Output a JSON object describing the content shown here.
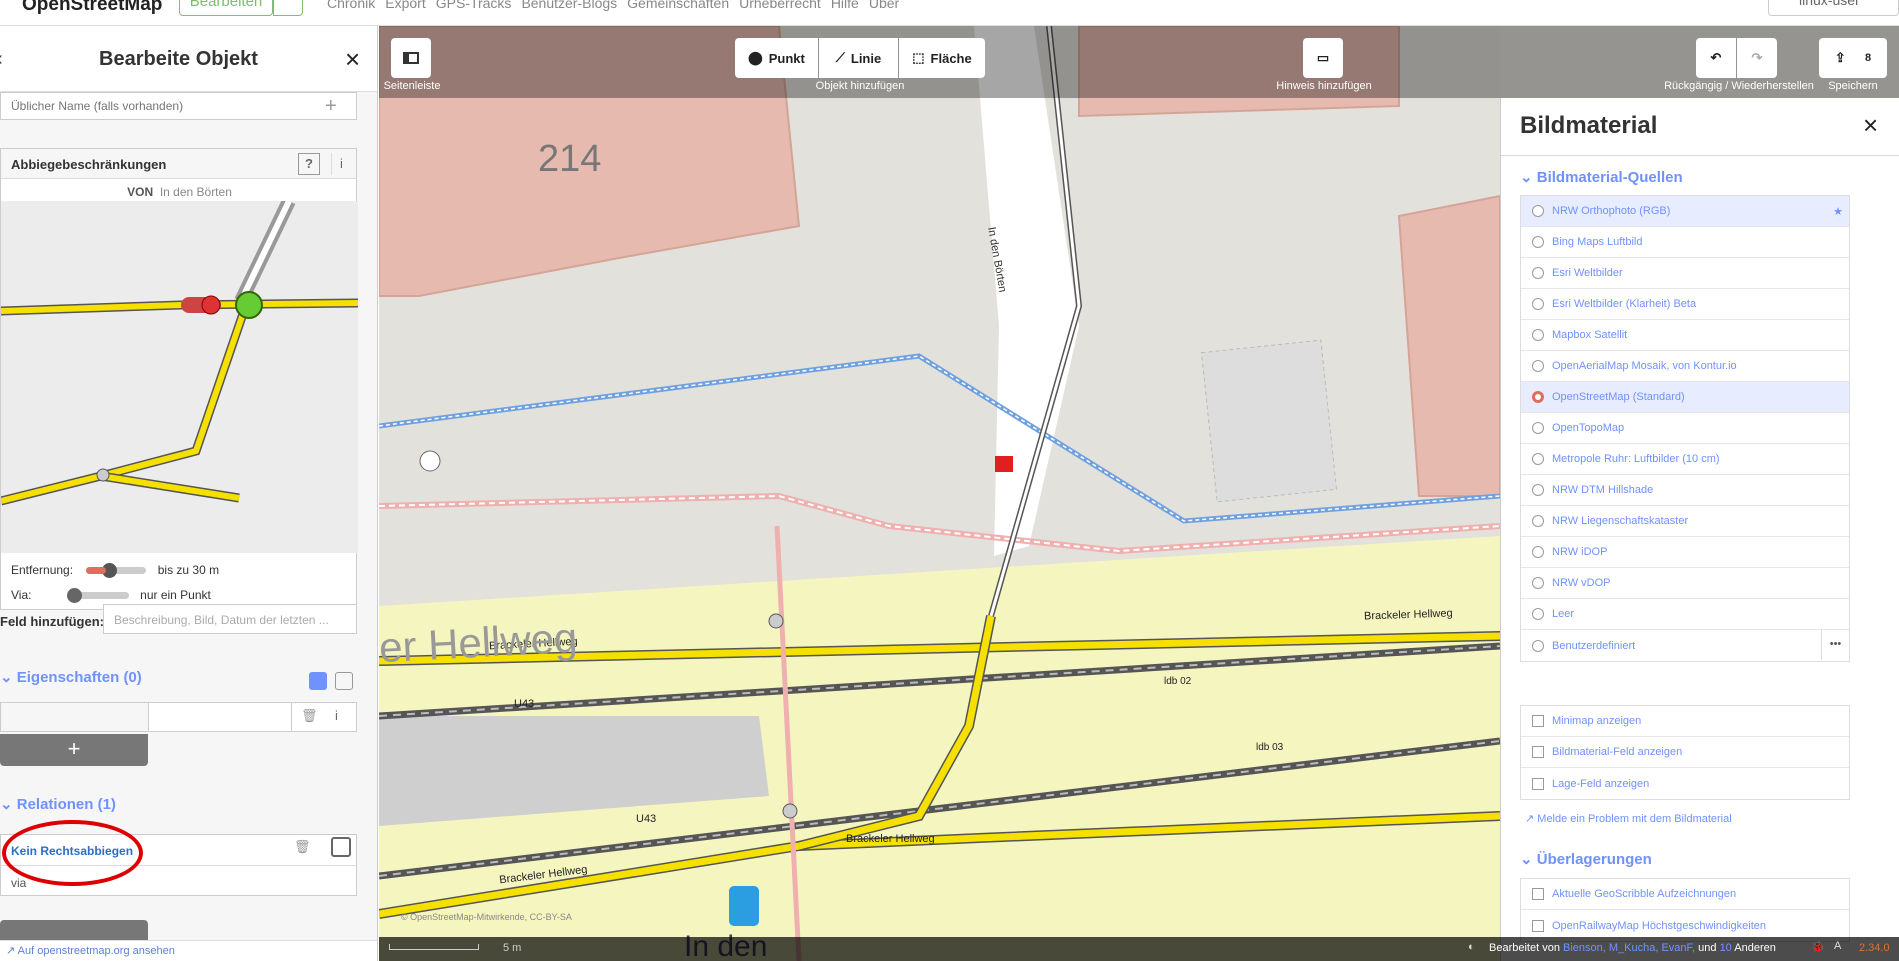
{
  "header": {
    "logo": "OpenStreetMap",
    "edit_button": "Bearbeiten",
    "nav": [
      "Chronik",
      "Export",
      "GPS-Tracks",
      "Benutzer-Blogs",
      "Gemeinschaften",
      "Urheberrecht",
      "Hilfe",
      "Über"
    ],
    "user": "linux-user"
  },
  "sidebar": {
    "title": "Bearbeite Objekt",
    "name_placeholder": "Üblicher Name (falls vorhanden)",
    "turn": {
      "label": "Abbiegebeschränkungen",
      "von_label": "VON",
      "von_value": "In den Börten",
      "distance_label": "Entfernung:",
      "distance_value": "bis zu 30 m",
      "via_label": "Via:",
      "via_value": "nur ein Punkt"
    },
    "field_add_label": "Feld hinzufügen:",
    "field_add_placeholder": "Beschreibung, Bild, Datum der letzten ...",
    "tags_title": "Eigenschaften (0)",
    "add_tag": "+",
    "relations_title": "Relationen (1)",
    "relation_name": "Kein Rechtsabbiegen",
    "relation_role": "via",
    "footer_link": "Auf openstreetmap.org ansehen"
  },
  "toolbar": {
    "sidebar_toggle": "Seitenleiste",
    "point": "Punkt",
    "line": "Linie",
    "area": "Fläche",
    "add_object": "Objekt hinzufügen",
    "add_note": "Hinweis hinzufügen",
    "undo_redo": "Rückgängig / Wiederherstellen",
    "save_count": "8",
    "save": "Speichern"
  },
  "map_labels": {
    "building_number": "214",
    "street_vertical": "In den Börten",
    "hellweg1": "Brackeler Hellweg",
    "hellweg2": "Brackeler Hellweg",
    "hellweg3": "Brackeler Hellweg",
    "hellweg4": "Brackeler Hellweg",
    "big_hellweg": "er Hellweg",
    "u43a": "U43",
    "u43b": "U43",
    "ldb02": "ldb 02",
    "ldb03": "ldb 03",
    "in_den": "In den",
    "scale": "5 m",
    "attribution": "© OpenStreetMap-Mitwirkende, CC-BY-SA"
  },
  "bildmaterial": {
    "title": "Bildmaterial",
    "sources_title": "Bildmaterial-Quellen",
    "sources": [
      {
        "label": "NRW Orthophoto (RGB)",
        "selected": false,
        "highlight": true
      },
      {
        "label": "Bing Maps Luftbild"
      },
      {
        "label": "Esri Weltbilder"
      },
      {
        "label": "Esri Weltbilder (Klarheit) Beta"
      },
      {
        "label": "Mapbox Satellit"
      },
      {
        "label": "OpenAerialMap Mosaik, von Kontur.io"
      },
      {
        "label": "OpenStreetMap (Standard)",
        "selected": true
      },
      {
        "label": "OpenTopoMap"
      },
      {
        "label": "Metropole Ruhr: Luftbilder (10 cm)"
      },
      {
        "label": "NRW DTM Hillshade"
      },
      {
        "label": "NRW Liegenschaftskataster"
      },
      {
        "label": "NRW iDOP"
      },
      {
        "label": "NRW vDOP"
      },
      {
        "label": "Leer"
      },
      {
        "label": "Benutzerdefiniert"
      }
    ],
    "options": [
      "Minimap anzeigen",
      "Bildmaterial-Feld anzeigen",
      "Lage-Feld anzeigen"
    ],
    "report": "Melde ein Problem mit dem Bildmaterial",
    "overlays_title": "Überlagerungen",
    "overlays": [
      "Aktuelle GeoScribble Aufzeichnungen",
      "OpenRailwayMap Höchstgeschwindigkeiten"
    ]
  },
  "footer": {
    "edited_by": "Bearbeitet von",
    "editors": "Bienson, M_Kucha, EvanF,",
    "and": "und",
    "others_count": "10",
    "others": "Anderen",
    "version": "2.34.0"
  },
  "colors": {
    "accent": "#7092ff",
    "road_yellow": "#f5e000",
    "building": "#e8b4a8"
  }
}
